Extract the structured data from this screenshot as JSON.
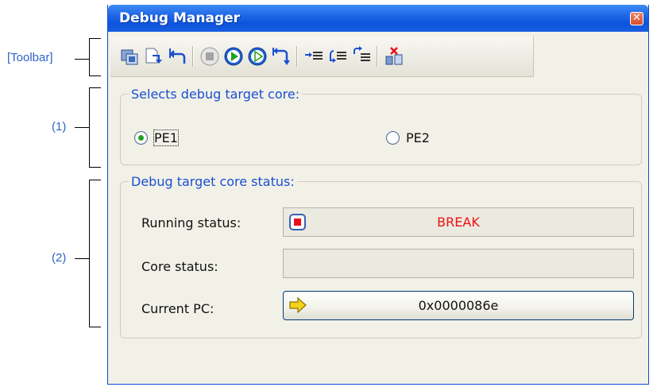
{
  "annotations": {
    "toolbar": "[Toolbar]",
    "area1": "(1)",
    "area2": "(2)"
  },
  "window": {
    "title": "Debug Manager",
    "close_icon": "close-icon"
  },
  "toolbar": {
    "icons": [
      "select-core-icon",
      "step-in-icon",
      "return-icon",
      "stop-icon",
      "go-icon",
      "run-icon",
      "restart-icon",
      "synchronize-icon",
      "step-over-icon",
      "step-out-icon",
      "disconnect-icon"
    ]
  },
  "core_select": {
    "legend": "Selects debug target core:",
    "options": [
      {
        "label": "PE1",
        "selected": true
      },
      {
        "label": "PE2",
        "selected": false
      }
    ]
  },
  "core_status": {
    "legend": "Debug target core status:",
    "running_status_label": "Running status:",
    "running_status_value": "BREAK",
    "core_status_label": "Core status:",
    "core_status_value": "",
    "current_pc_label": "Current PC:",
    "current_pc_value": "0x0000086e"
  },
  "colors": {
    "title_bar": "#0c54dd",
    "annotation": "#2f64c8",
    "break": "#ee1010",
    "legend": "#1a4fd0"
  }
}
